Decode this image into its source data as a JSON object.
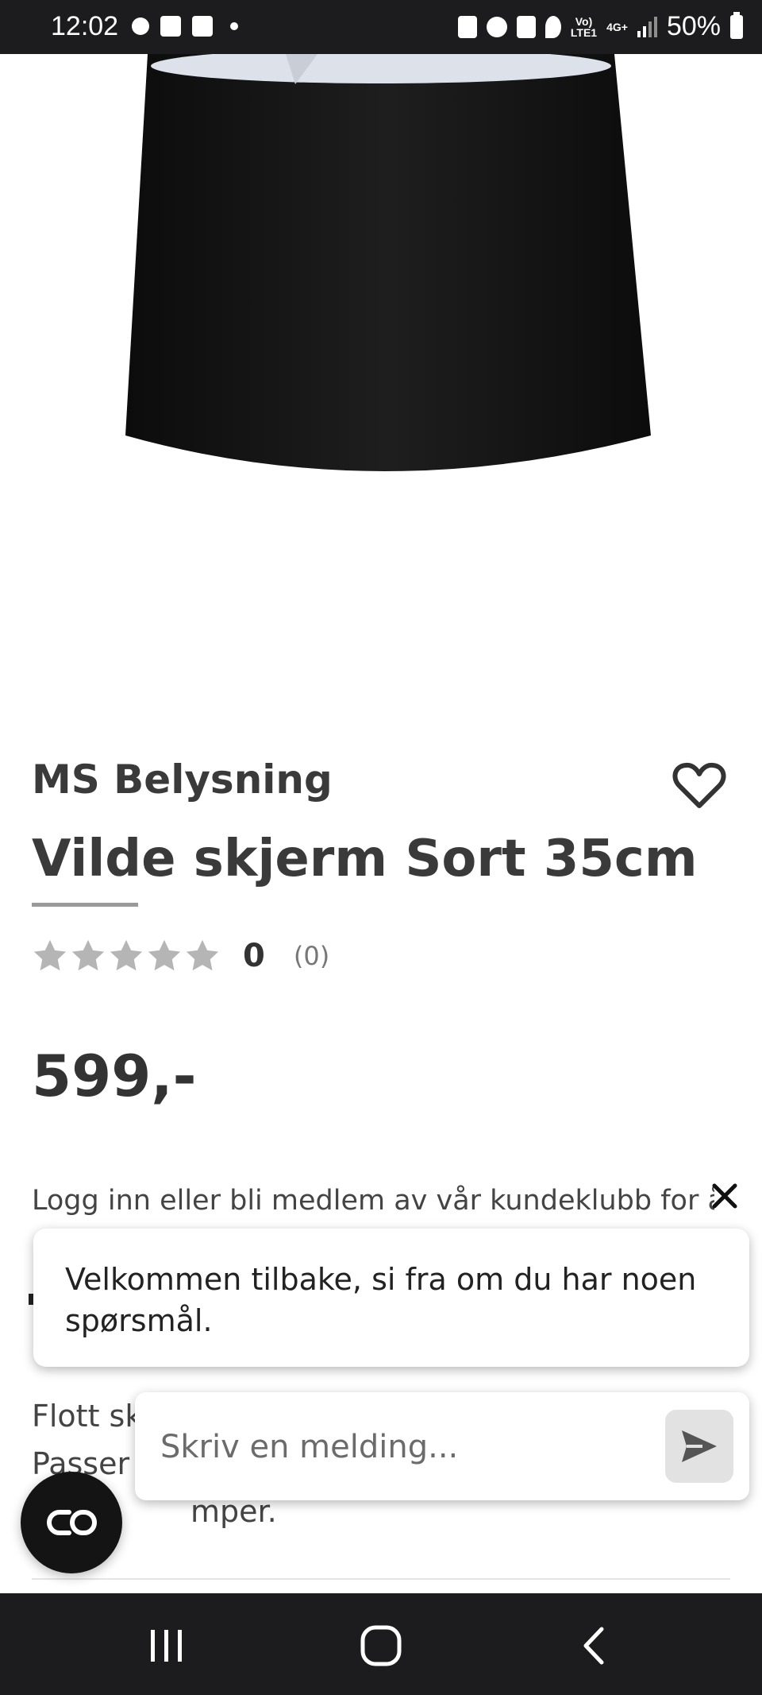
{
  "status_bar": {
    "time": "12:02",
    "battery": "50%",
    "network_top": "Vo)",
    "network_bottom": "LTE1",
    "network_type": "4G+"
  },
  "product": {
    "brand": "MS Belysning",
    "title": "Vilde skjerm Sort 35cm",
    "rating_value": "0",
    "rating_count": "(0)",
    "rating_stars": 0,
    "price": "599,-",
    "member_text": "Logg inn eller bli medlem av vår kundeklubb for å",
    "description_line1": "Flott sk",
    "description_line2": "Passer",
    "description_line3": "mper."
  },
  "chat": {
    "message": "Velkommen tilbake, si fra om du har noen spørsmål.",
    "input_placeholder": "Skriv en melding..."
  },
  "icons": {
    "favorite": "heart-outline-icon",
    "close": "close-icon",
    "send": "send-icon",
    "launcher": "chat-launcher-icon"
  },
  "colors": {
    "text_dark": "#3a3a3a",
    "star_empty": "#b5b5b5",
    "bar_bg": "#1c1c1e"
  }
}
